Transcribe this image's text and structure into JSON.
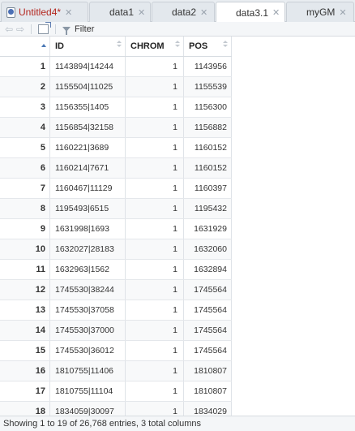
{
  "tabs": [
    {
      "label": "Untitled4*",
      "icon": "r-script-icon",
      "modified": true,
      "active": false
    },
    {
      "label": "data1",
      "icon": "data-grid-icon",
      "active": false
    },
    {
      "label": "data2",
      "icon": "data-grid-icon",
      "active": false
    },
    {
      "label": "data3.1",
      "icon": "data-grid-icon",
      "active": true
    },
    {
      "label": "myGM",
      "icon": "data-grid-icon",
      "active": false
    }
  ],
  "toolbar": {
    "filter_label": "Filter"
  },
  "table": {
    "columns": [
      "ID",
      "CHROM",
      "POS"
    ],
    "rows": [
      {
        "idx": "1",
        "id": "1143894|14244",
        "chrom": "1",
        "pos": "1143956"
      },
      {
        "idx": "2",
        "id": "1155504|11025",
        "chrom": "1",
        "pos": "1155539"
      },
      {
        "idx": "3",
        "id": "1156355|1405",
        "chrom": "1",
        "pos": "1156300"
      },
      {
        "idx": "4",
        "id": "1156854|32158",
        "chrom": "1",
        "pos": "1156882"
      },
      {
        "idx": "5",
        "id": "1160221|3689",
        "chrom": "1",
        "pos": "1160152"
      },
      {
        "idx": "6",
        "id": "1160214|7671",
        "chrom": "1",
        "pos": "1160152"
      },
      {
        "idx": "7",
        "id": "1160467|11129",
        "chrom": "1",
        "pos": "1160397"
      },
      {
        "idx": "8",
        "id": "1195493|6515",
        "chrom": "1",
        "pos": "1195432"
      },
      {
        "idx": "9",
        "id": "1631998|1693",
        "chrom": "1",
        "pos": "1631929"
      },
      {
        "idx": "10",
        "id": "1632027|28183",
        "chrom": "1",
        "pos": "1632060"
      },
      {
        "idx": "11",
        "id": "1632963|1562",
        "chrom": "1",
        "pos": "1632894"
      },
      {
        "idx": "12",
        "id": "1745530|38244",
        "chrom": "1",
        "pos": "1745564"
      },
      {
        "idx": "13",
        "id": "1745530|37058",
        "chrom": "1",
        "pos": "1745564"
      },
      {
        "idx": "14",
        "id": "1745530|37000",
        "chrom": "1",
        "pos": "1745564"
      },
      {
        "idx": "15",
        "id": "1745530|36012",
        "chrom": "1",
        "pos": "1745564"
      },
      {
        "idx": "16",
        "id": "1810755|11406",
        "chrom": "1",
        "pos": "1810807"
      },
      {
        "idx": "17",
        "id": "1810755|11104",
        "chrom": "1",
        "pos": "1810807"
      },
      {
        "idx": "18",
        "id": "1834059|30097",
        "chrom": "1",
        "pos": "1834029"
      }
    ]
  },
  "status": {
    "text": "Showing 1 to 19 of 26,768 entries, 3 total columns"
  }
}
